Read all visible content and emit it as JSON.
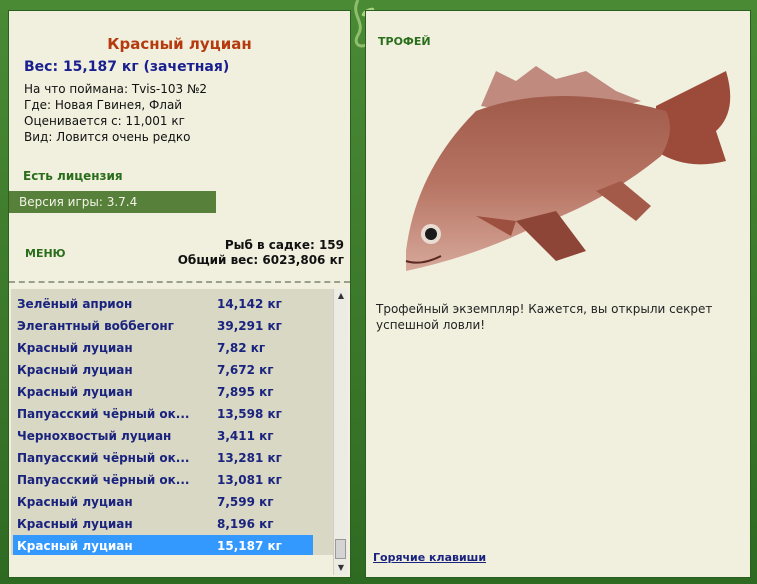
{
  "fish": {
    "name": "Красный луциан",
    "weight": "Вес: 15,187 кг (зачетная)",
    "caught_on": "На что поймана: Tvis-103 №2",
    "where": "Где: Новая Гвинея, Флай",
    "valued_from": "Оценивается с: 11,001 кг",
    "species_note": "Вид: Ловится очень редко"
  },
  "license_text": "Есть лицензия",
  "version_text": "Версия игры: 3.7.4",
  "menu_label": "МЕНЮ",
  "stats": {
    "fish_in_keepnet": "Рыб в садке: 159",
    "total_weight": "Общий вес: 6023,806 кг"
  },
  "catch_list": [
    {
      "name": "Зелёный априон",
      "weight": "14,142 кг"
    },
    {
      "name": "Элегантный воббегонг",
      "weight": "39,291 кг"
    },
    {
      "name": "Красный луциан",
      "weight": "7,82 кг"
    },
    {
      "name": "Красный луциан",
      "weight": "7,672 кг"
    },
    {
      "name": "Красный луциан",
      "weight": "7,895 кг"
    },
    {
      "name": "Папуасский чёрный ок...",
      "weight": "13,598 кг"
    },
    {
      "name": "Чернохвостый луциан",
      "weight": "3,411 кг"
    },
    {
      "name": "Папуасский чёрный ок...",
      "weight": "13,281 кг"
    },
    {
      "name": "Папуасский чёрный ок...",
      "weight": "13,081 кг"
    },
    {
      "name": "Красный луциан",
      "weight": "7,599 кг"
    },
    {
      "name": "Красный луциан",
      "weight": "8,196 кг"
    },
    {
      "name": "Красный луциан",
      "weight": "15,187 кг"
    }
  ],
  "selected_index": 11,
  "trophy": {
    "title": "ТРОФЕЙ",
    "text": "Трофейный экземпляр! Кажется, вы открыли секрет успешной ловли!"
  },
  "hotkeys_link": "Горячие клавиши",
  "colors": {
    "frame_green": "#3f7a2e",
    "panel_bg": "#f1f0df",
    "fish_name": "#b53a0e",
    "list_text": "#1a237e",
    "selection": "#3399ff"
  }
}
